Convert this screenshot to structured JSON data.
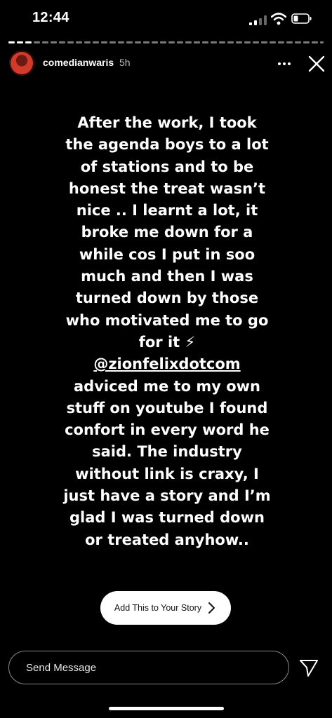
{
  "status_bar": {
    "time": "12:44"
  },
  "story": {
    "username": "comedianwaris",
    "posted_ago": "5h",
    "lines_before": "After the work, I took\nthe agenda boys to a lot\nof stations and to be\nhonest the treat wasn’t\nnice .. I learnt a lot, it\nbroke me down for a\nwhile cos I put in soo\nmuch and then I was\nturned down by those\nwho motivated me to go\nfor it ⚡",
    "mention": "@zionfelixdotcom",
    "lines_after": "adviced me to my own\nstuff on youtube I found\nconfort in every word he\nsaid. The industry\nwithout link is craxy, I\njust have a story and I’m\nglad I was turned down\nor treated anyhow.."
  },
  "add_story_button": {
    "label": "Add This to Your Story"
  },
  "message": {
    "placeholder": "Send Message"
  },
  "icons": {
    "more": "more-horizontal-icon",
    "close": "close-icon",
    "send": "paper-plane-icon",
    "chevron": "chevron-right-icon"
  },
  "colors": {
    "background": "#000000",
    "text": "#ffffff",
    "button_bg": "#ffffff"
  }
}
